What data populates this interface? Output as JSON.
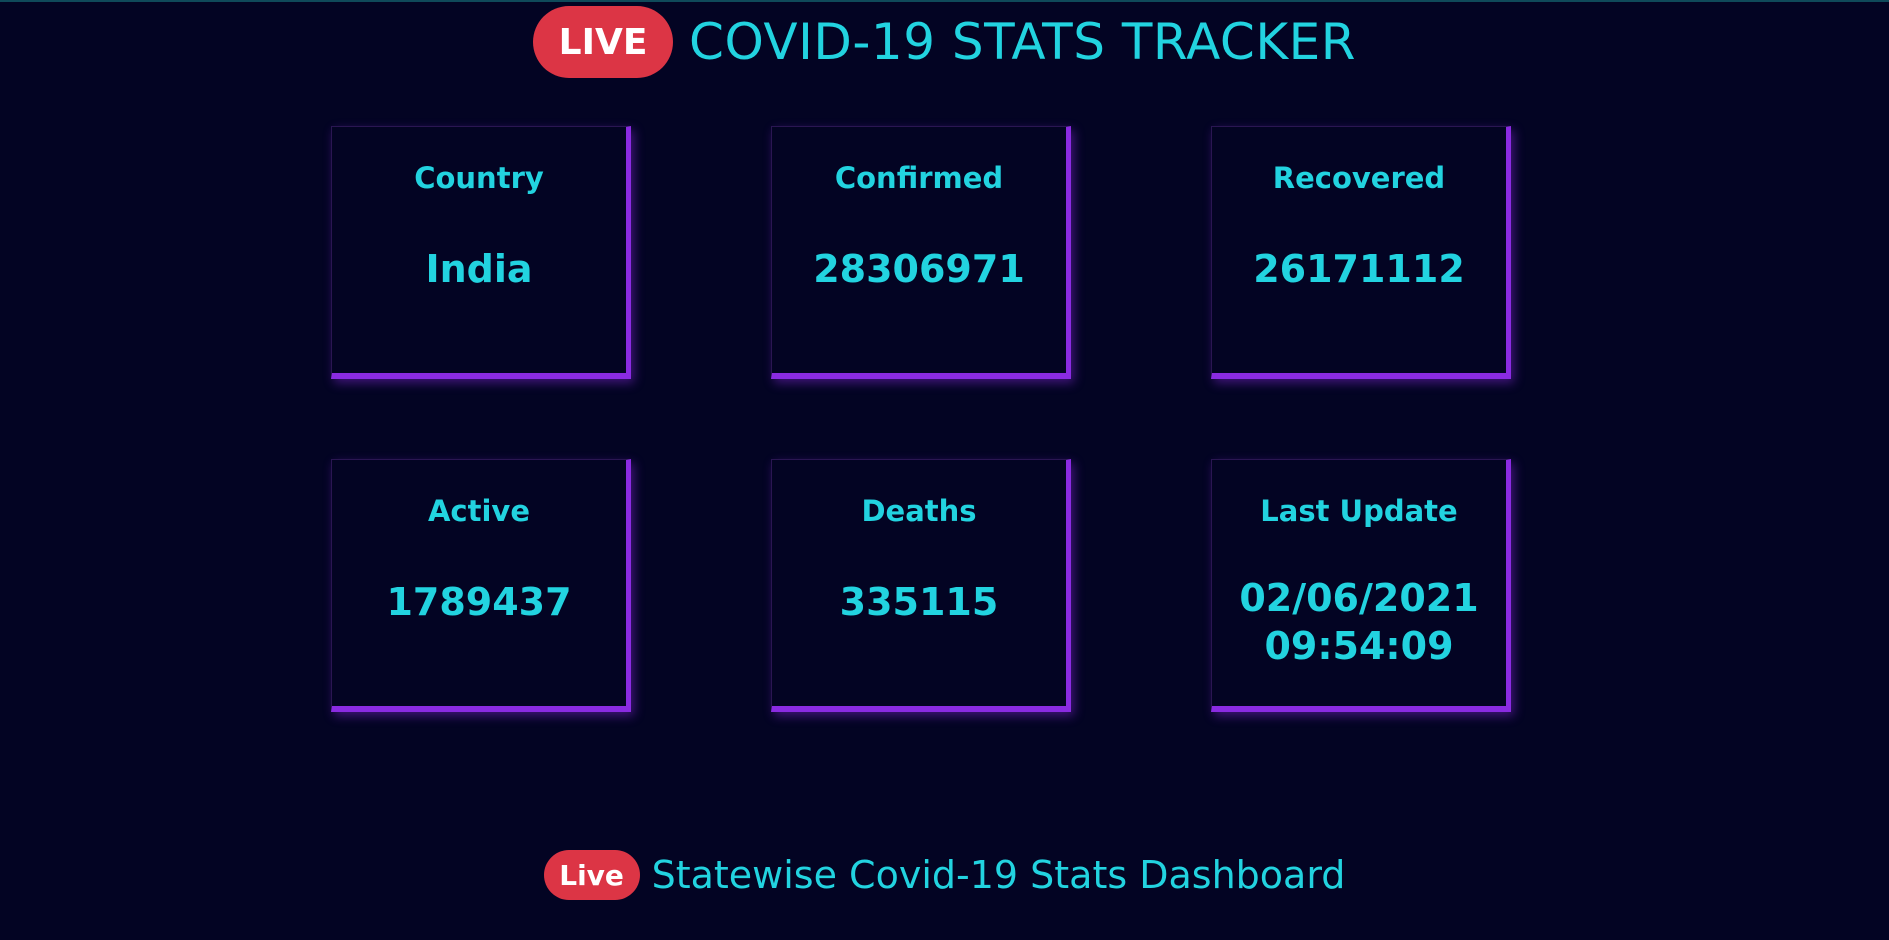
{
  "header": {
    "live_label": "LIVE",
    "title": "COVID-19 STATS TRACKER"
  },
  "cards": [
    {
      "label": "Country",
      "value": "India"
    },
    {
      "label": "Confirmed",
      "value": "28306971"
    },
    {
      "label": "Recovered",
      "value": "26171112"
    },
    {
      "label": "Active",
      "value": "1789437"
    },
    {
      "label": "Deaths",
      "value": "335115"
    },
    {
      "label": "Last Update",
      "value_date": "02/06/2021",
      "value_time": "09:54:09"
    }
  ],
  "footer": {
    "live_label": "Live",
    "link_text": "Statewise Covid-19 Stats Dashboard"
  },
  "colors": {
    "background": "#030423",
    "accent_text": "#22d3e0",
    "live_badge": "#dc3545",
    "card_border": "#8a2be2"
  }
}
